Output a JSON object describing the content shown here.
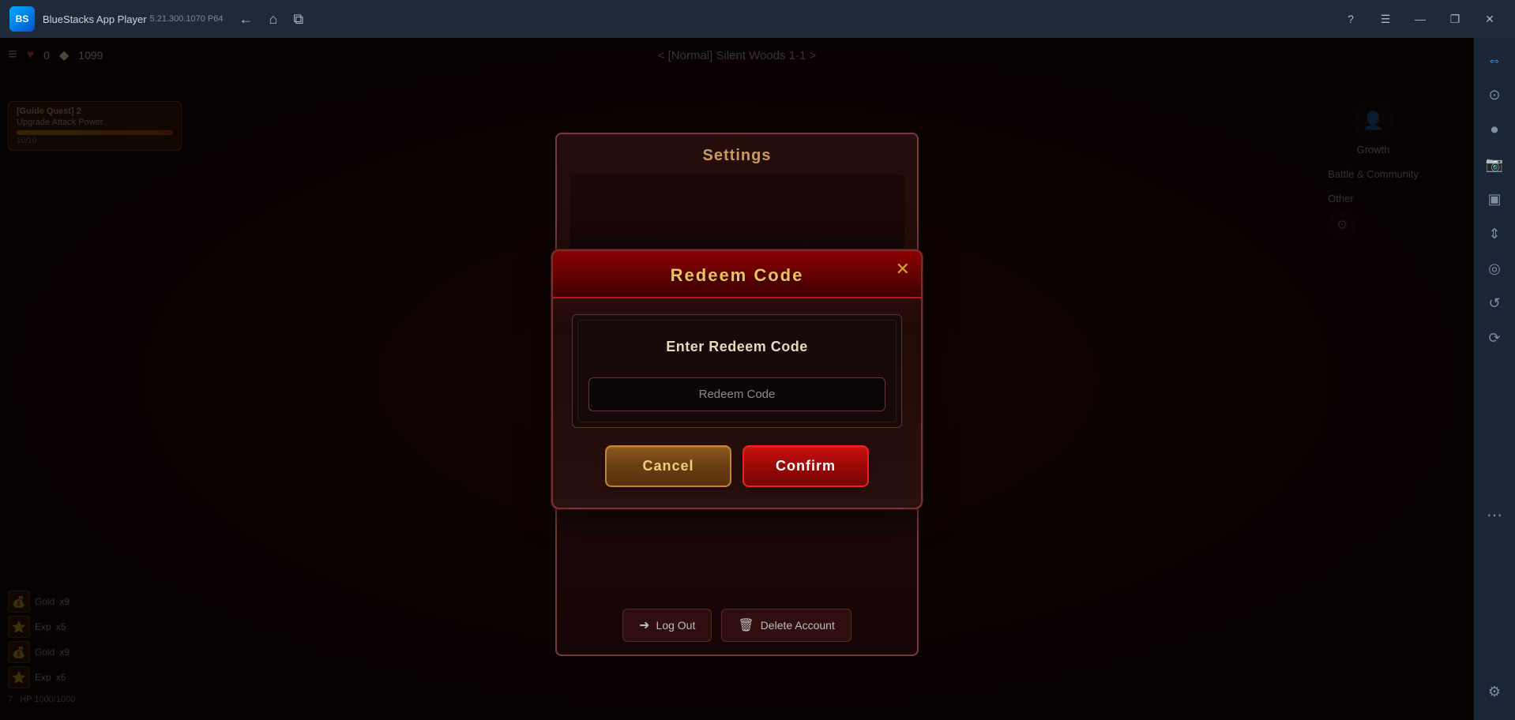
{
  "titlebar": {
    "app_name": "BlueStacks App Player",
    "version": "5.21.300.1070  P64",
    "nav_back": "←",
    "nav_home": "⌂",
    "nav_tabs": "⧉",
    "help_icon": "?",
    "menu_icon": "☰",
    "min_icon": "—",
    "restore_icon": "❐",
    "close_icon": "✕",
    "logo_text": "BS"
  },
  "sidebar": {
    "icons": [
      "?",
      "☰",
      "—",
      "❐",
      "✕"
    ],
    "right_icons": [
      {
        "name": "sidebar-resize-icon",
        "glyph": "⇔"
      },
      {
        "name": "sidebar-lock-icon",
        "glyph": "⊙"
      },
      {
        "name": "sidebar-camera-icon",
        "glyph": "◎"
      },
      {
        "name": "sidebar-screenshot-icon",
        "glyph": "▣"
      },
      {
        "name": "sidebar-resize2-icon",
        "glyph": "⇕"
      },
      {
        "name": "sidebar-camera2-icon",
        "glyph": "📷"
      },
      {
        "name": "sidebar-record-icon",
        "glyph": "⏺"
      },
      {
        "name": "sidebar-refresh-icon",
        "glyph": "↺"
      },
      {
        "name": "sidebar-more-icon",
        "glyph": "⋯"
      },
      {
        "name": "sidebar-gear-icon",
        "glyph": "⚙"
      }
    ]
  },
  "game_hud": {
    "heart_count": "0",
    "gold_count": "1099",
    "stage_title": "< [Normal] Silent Woods 1-1 >"
  },
  "settings_dialog": {
    "title": "Settings",
    "close_icon": "✕",
    "log_out_label": "Log Out",
    "delete_account_label": "Delete Account"
  },
  "redeem_dialog": {
    "title": "Redeem Code",
    "close_icon": "✕",
    "prompt_text": "Enter Redeem Code",
    "input_placeholder": "Redeem Code",
    "cancel_label": "Cancel",
    "confirm_label": "Confirm"
  },
  "quest": {
    "title": "[Guide Quest] 2",
    "subtitle": "Upgrade Attack Power",
    "progress": "10/10"
  },
  "right_panel": {
    "growth_label": "Growth",
    "battle_label": "Battle & Community",
    "other_label": "Other"
  },
  "items": [
    {
      "icon": "💰",
      "name": "Gold",
      "count": "x9"
    },
    {
      "icon": "⭐",
      "name": "Exp",
      "count": "x5"
    },
    {
      "icon": "💰",
      "name": "Gold",
      "count": "x9"
    },
    {
      "icon": "⭐",
      "name": "Exp",
      "count": "x5"
    }
  ],
  "character": {
    "level": "7",
    "hp": "HP 1000/1000"
  },
  "colors": {
    "accent_gold": "#f0c060",
    "accent_red": "#cc1010",
    "btn_cancel_bg": "#8b5a20",
    "btn_confirm_bg": "#cc1010",
    "dialog_border": "#7a3030",
    "header_bg": "#8b0000"
  }
}
